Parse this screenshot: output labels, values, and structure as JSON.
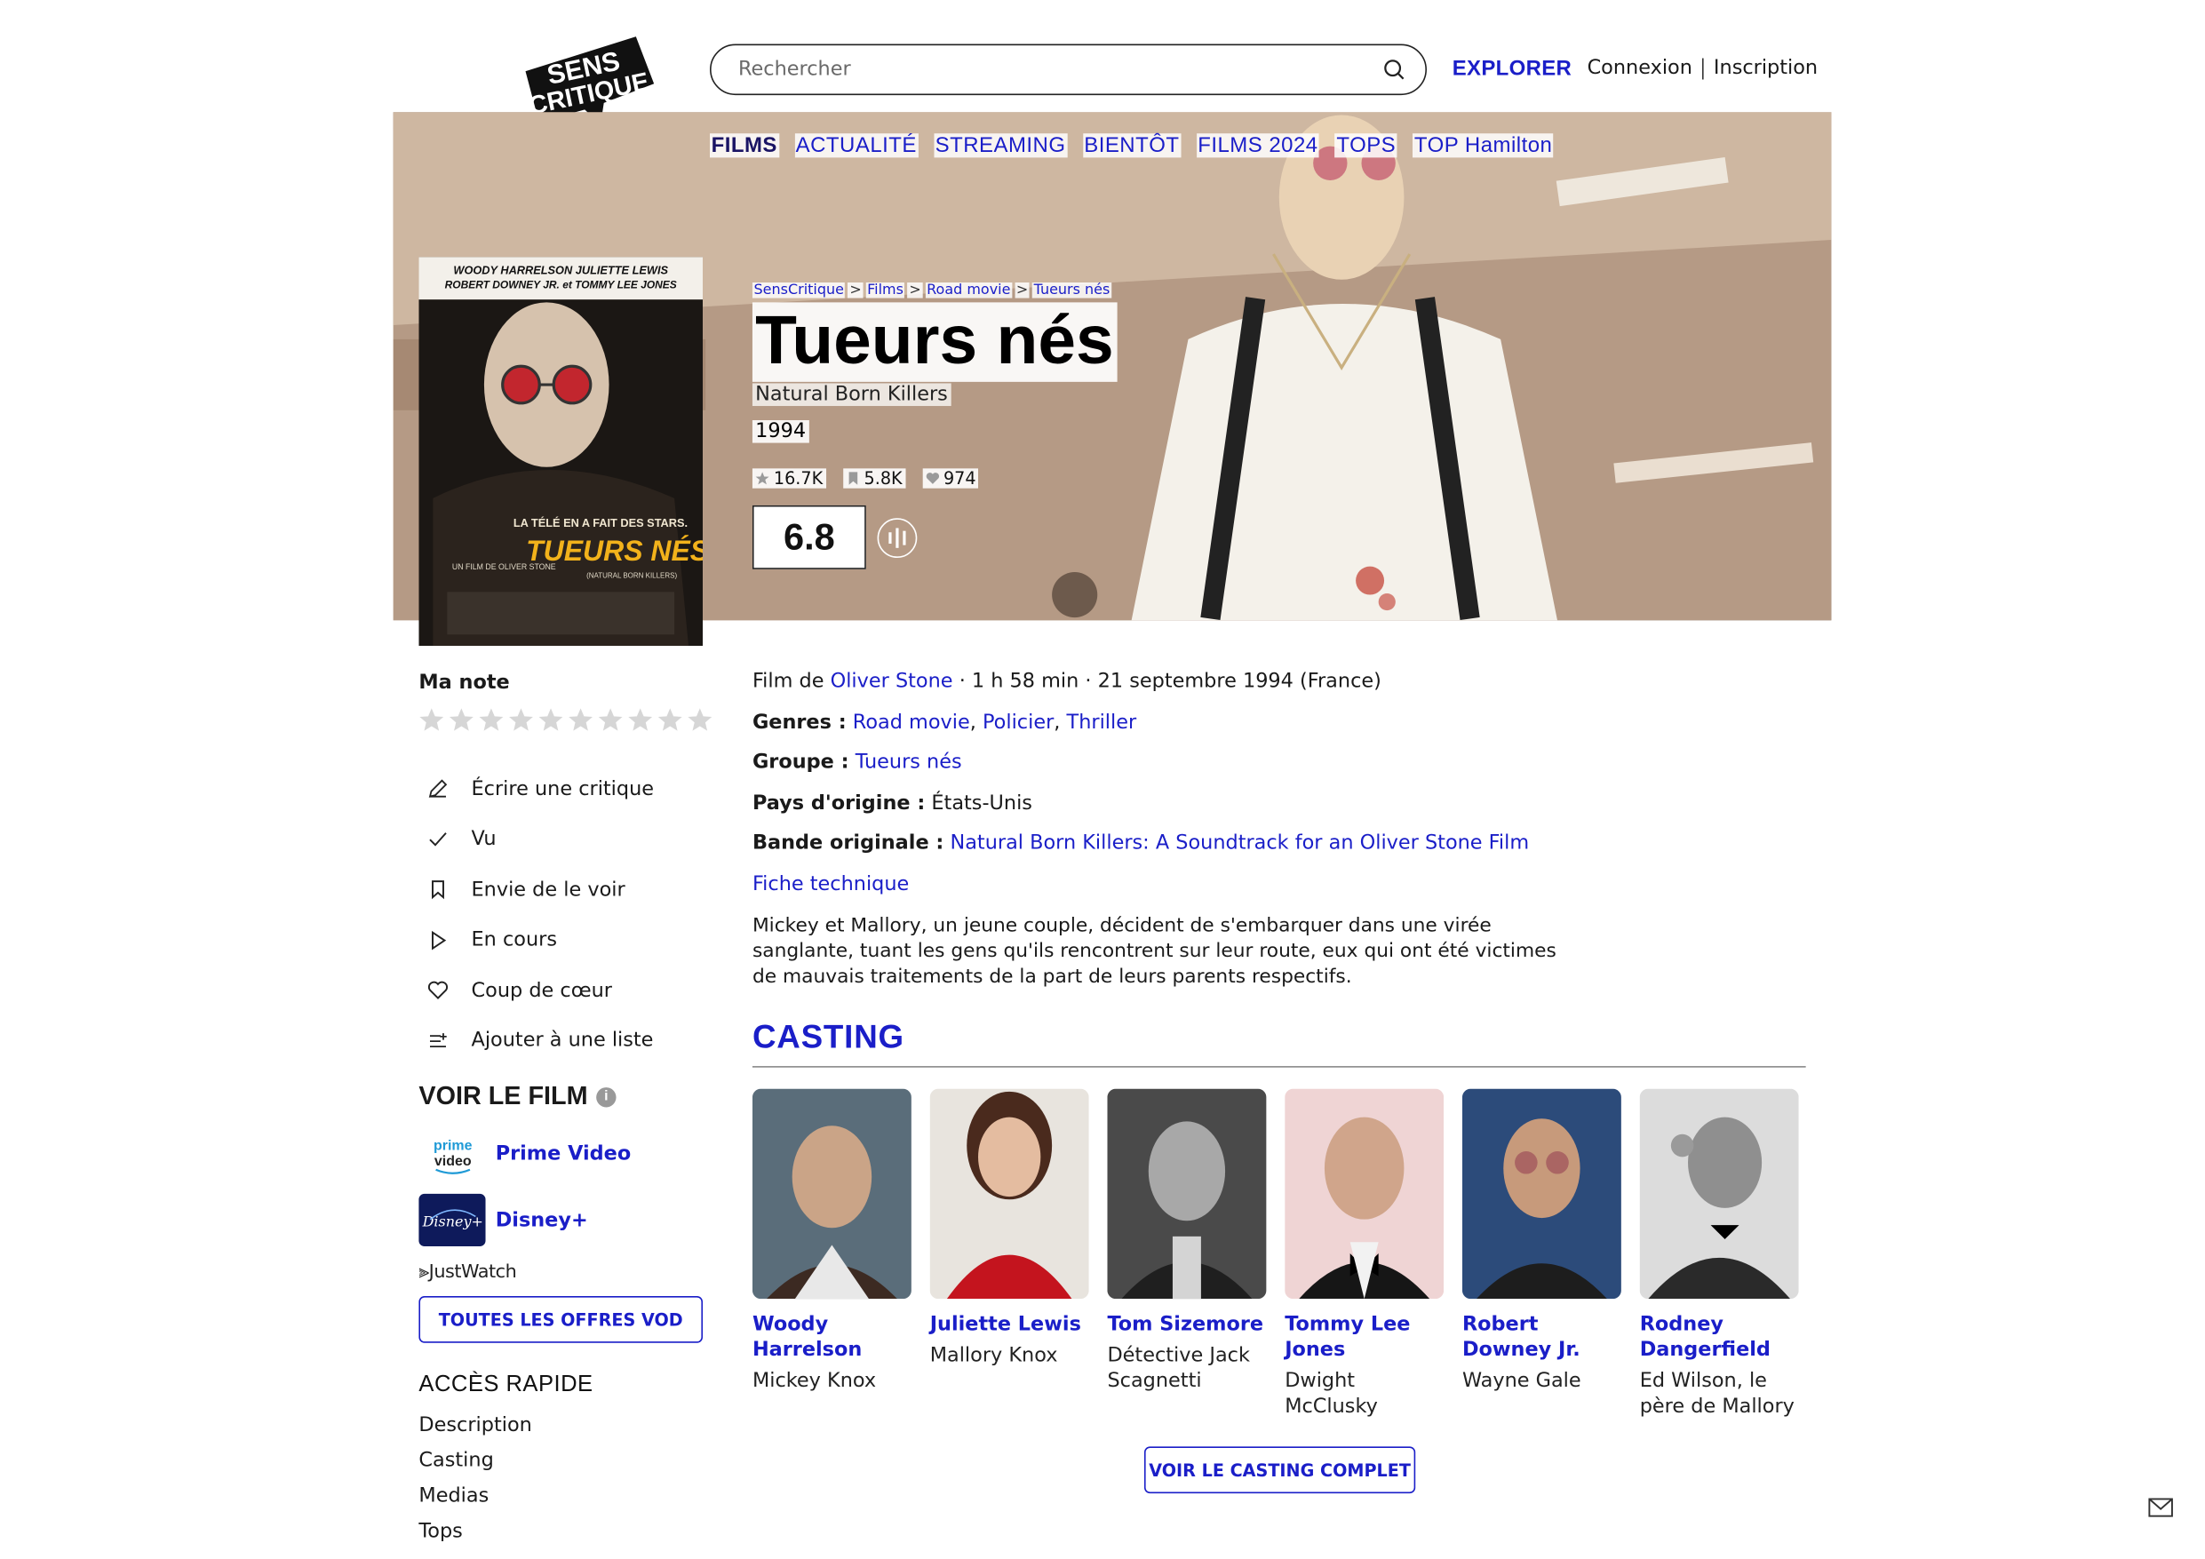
{
  "header": {
    "logo_text": "SENS CRITIQUE",
    "search_placeholder": "Rechercher",
    "explore_label": "EXPLORER",
    "login_label": "Connexion",
    "signup_label": "Inscription"
  },
  "nav": [
    "FILMS",
    "ACTUALITÉ",
    "STREAMING",
    "BIENTÔT",
    "FILMS 2024",
    "TOPS",
    "TOP Hamilton"
  ],
  "breadcrumb": [
    "SensCritique",
    "Films",
    "Road movie",
    "Tueurs nés"
  ],
  "movie": {
    "title": "Tueurs nés",
    "original_title": "Natural Born Killers",
    "year": "1994",
    "stats": {
      "ratings": "16.7K",
      "wishlist": "5.8K",
      "favorites": "974"
    },
    "score": "6.8",
    "poster_text": {
      "actors_line1": "WOODY HARRELSON  JULIETTE LEWIS",
      "actors_line2": "ROBERT DOWNEY JR. et TOMMY LEE JONES",
      "tagline": "LA TÉLÉ EN A FAIT DES STARS.",
      "title": "TUEURS NÉS",
      "subtitle": "(NATURAL BORN KILLERS)",
      "director": "UN FILM DE OLIVER STONE"
    }
  },
  "sidebar": {
    "my_rating_label": "Ma note",
    "actions": [
      {
        "icon": "pencil-icon",
        "label": "Écrire une critique"
      },
      {
        "icon": "check-icon",
        "label": "Vu"
      },
      {
        "icon": "bookmark-icon",
        "label": "Envie de le voir"
      },
      {
        "icon": "play-icon",
        "label": "En cours"
      },
      {
        "icon": "heart-icon",
        "label": "Coup de cœur"
      },
      {
        "icon": "list-add-icon",
        "label": "Ajouter à une liste"
      }
    ],
    "watch_title": "VOIR LE FILM",
    "providers": [
      {
        "name": "Prime Video",
        "logo_text": "prime video"
      },
      {
        "name": "Disney+",
        "logo_text": "Disney+"
      }
    ],
    "justwatch_label": "JustWatch",
    "vod_button": "TOUTES LES OFFRES VOD",
    "quick_access_title": "ACCÈS RAPIDE",
    "quick_links": [
      "Description",
      "Casting",
      "Medias",
      "Tops"
    ]
  },
  "details": {
    "film_by_prefix": "Film de",
    "director": "Oliver Stone",
    "runtime_release": "· 1 h 58 min · 21 septembre 1994 (France)",
    "genres_label": "Genres :",
    "genres": [
      "Road movie",
      "Policier",
      "Thriller"
    ],
    "group_label": "Groupe :",
    "group": "Tueurs nés",
    "country_label": "Pays d'origine :",
    "country": "États-Unis",
    "soundtrack_label": "Bande originale :",
    "soundtrack": "Natural Born Killers: A Soundtrack for an Oliver Stone Film",
    "tech_sheet": "Fiche technique",
    "synopsis": "Mickey et Mallory, un jeune couple, décident de s'embarquer dans une virée sanglante, tuant les gens qu'ils rencontrent sur leur route, eux qui ont été victimes de mauvais traitements de la part de leurs parents respectifs."
  },
  "casting": {
    "title": "CASTING",
    "people": [
      {
        "name": "Woody Harrelson",
        "role": "Mickey Knox"
      },
      {
        "name": "Juliette Lewis",
        "role": "Mallory Knox"
      },
      {
        "name": "Tom Sizemore",
        "role": "Détective Jack Scagnetti"
      },
      {
        "name": "Tommy Lee Jones",
        "role": "Dwight McClusky"
      },
      {
        "name": "Robert Downey Jr.",
        "role": "Wayne Gale"
      },
      {
        "name": "Rodney Dangerfield",
        "role": "Ed Wilson, le père de Mallory"
      }
    ],
    "full_cast_button": "VOIR LE CASTING COMPLET"
  },
  "colors": {
    "accent": "#1a1ec8",
    "text": "#1a1a1a"
  }
}
